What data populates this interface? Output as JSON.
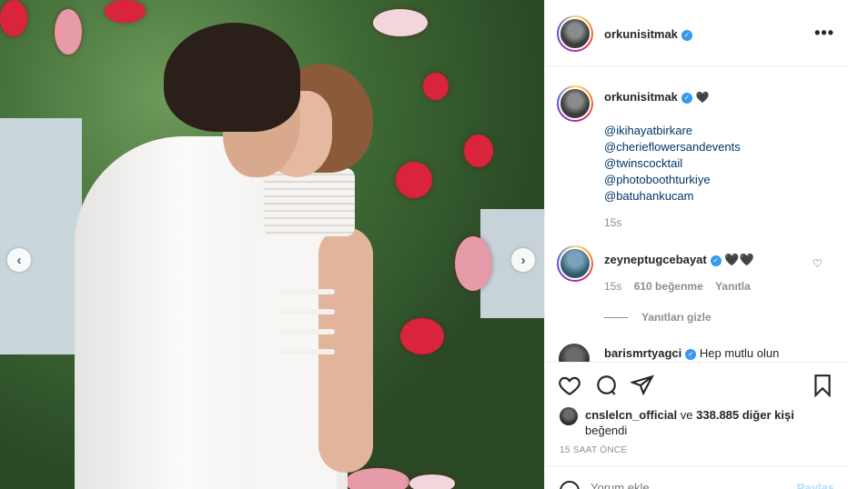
{
  "post": {
    "author": "orkunisitmak",
    "more_icon": "more-icon",
    "photo_alt": "wedding-photo"
  },
  "caption": {
    "username": "orkunisitmak",
    "heart": "🖤",
    "mentions": [
      "@ikihayatbirkare",
      "@cherieflowersandevents",
      "@twinscocktail",
      "@photoboothturkiye",
      "@batuhankucam"
    ],
    "time": "15s"
  },
  "comments": [
    {
      "username": "zeyneptugcebayat",
      "text": "🖤🖤",
      "time": "15s",
      "likes": "610 beğenme",
      "reply": "Yanıtla",
      "hide_replies": "Yanıtları gizle"
    },
    {
      "username": "barismrtyagci",
      "text": "Hep mutlu olun"
    }
  ],
  "likes": {
    "liker": "cnslelcn_official",
    "connector": "ve",
    "others": "338.885 diğer kişi",
    "suffix": "beğendi"
  },
  "post_time": "15 SAAT ÖNCE",
  "add_comment": {
    "placeholder": "Yorum ekle...",
    "post_label": "Paylaş"
  },
  "colors": {
    "verified": "#3897f0",
    "mention": "#00376b",
    "meta": "#8e8e8e"
  }
}
